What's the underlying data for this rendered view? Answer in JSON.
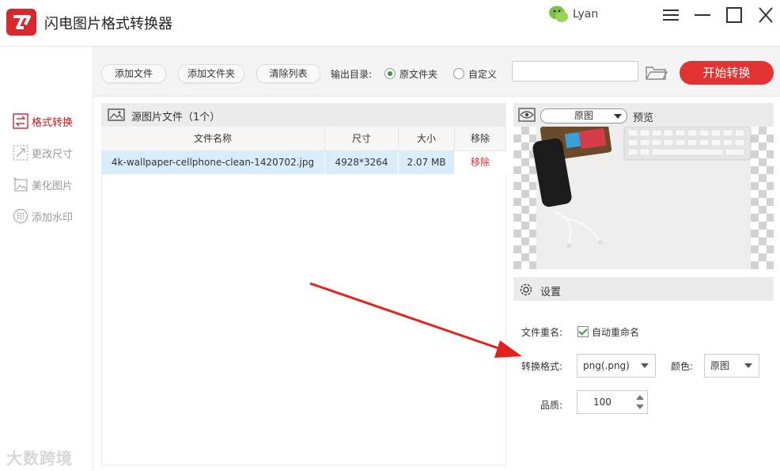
{
  "app": {
    "title": "闪电图片格式转换器",
    "user": "Lyan",
    "accent": "#e23232"
  },
  "sidebar": {
    "items": [
      {
        "label": "格式转换",
        "icon": "swap-icon",
        "active": true
      },
      {
        "label": "更改尺寸",
        "icon": "resize-icon",
        "active": false
      },
      {
        "label": "美化图片",
        "icon": "beautify-icon",
        "active": false
      },
      {
        "label": "添加水印",
        "icon": "watermark-icon",
        "active": false
      }
    ]
  },
  "toolbar": {
    "add_file": "添加文件",
    "add_folder": "添加文件夹",
    "clear_list": "清除列表",
    "output_label": "输出目录:",
    "radio_source": "原文件夹",
    "radio_custom": "自定义",
    "path_value": "",
    "start": "开始转换"
  },
  "list": {
    "title": "源图片文件（1个）",
    "columns": [
      "文件名称",
      "尺寸",
      "大小",
      "移除"
    ],
    "rows": [
      {
        "name": "4k-wallpaper-cellphone-clean-1420702.jpg",
        "size": "4928*3264",
        "filesize": "2.07 MB",
        "remove": "移除"
      }
    ]
  },
  "preview": {
    "mode": "原图",
    "label": "预览"
  },
  "settings": {
    "title": "设置",
    "rename_label": "文件重名:",
    "auto_rename": "自动重命名",
    "format_label": "转换格式:",
    "format_value": "png(.png)",
    "color_label": "颜色:",
    "color_value": "原图",
    "quality_label": "品质:",
    "quality_value": "100"
  },
  "watermark": "大数跨境"
}
